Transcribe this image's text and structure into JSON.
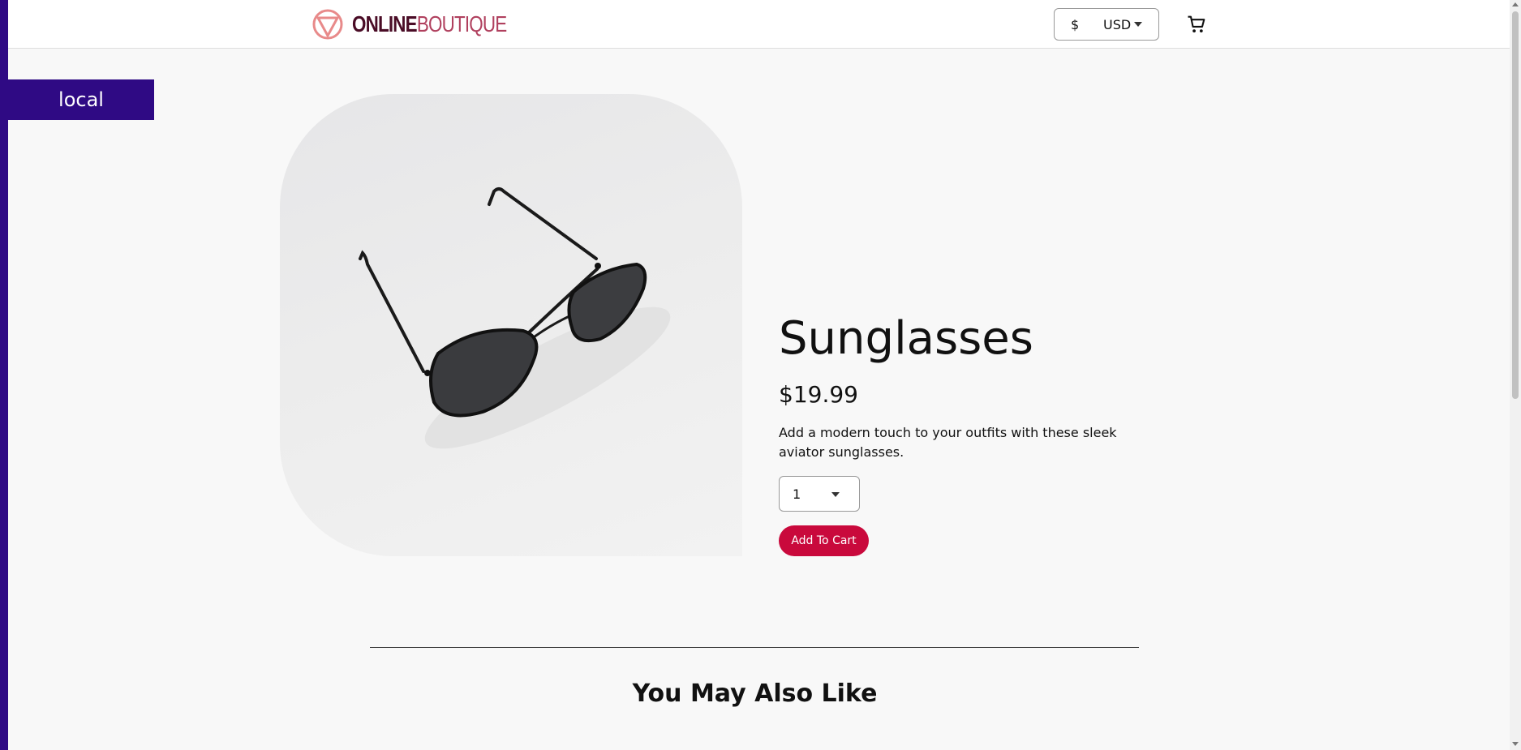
{
  "header": {
    "logo_bold": "ONLINE",
    "logo_light": "BOUTIQUE",
    "currency_symbol": "$",
    "currency_code": "USD",
    "cart_icon": "cart-icon"
  },
  "environment_tag": "local",
  "product": {
    "name": "Sunglasses",
    "price": "$19.99",
    "description": "Add a modern touch to your outfits with these sleek aviator sunglasses.",
    "quantity": "1",
    "add_to_cart_label": "Add To Cart",
    "image_icon": "sunglasses-product-image"
  },
  "recommendations": {
    "heading": "You May Also Like"
  },
  "colors": {
    "brand_dark": "#4a0c26",
    "brand_accent": "#c9093c",
    "env_tag": "#2f0a84",
    "background": "#f8f8f8"
  }
}
